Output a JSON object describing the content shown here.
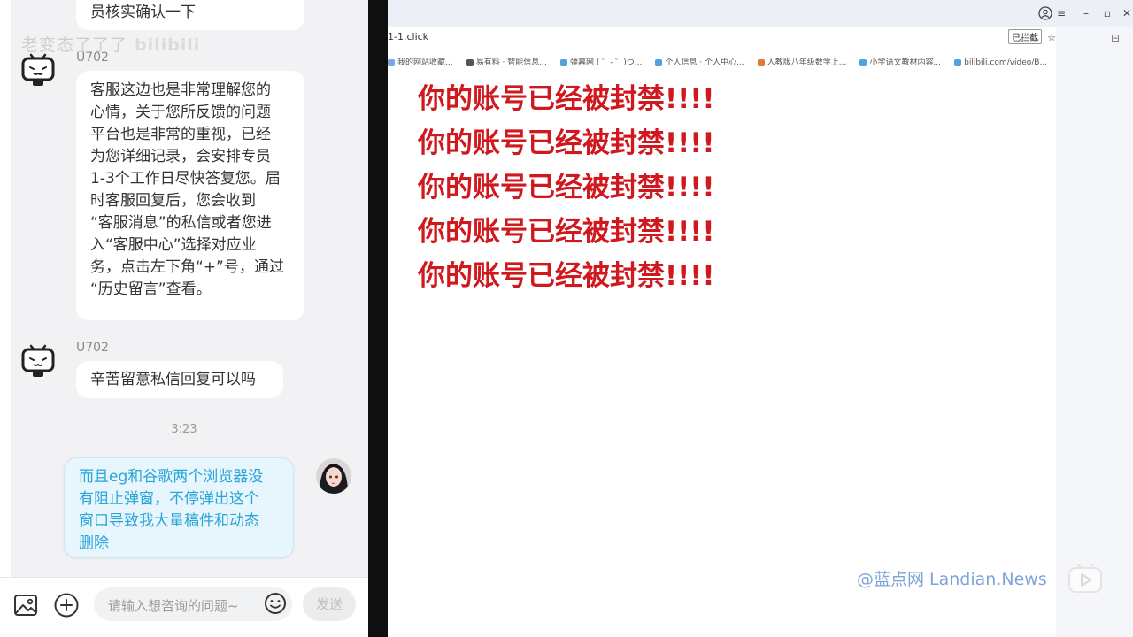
{
  "chat": {
    "watermark": "老变态了了了",
    "watermark_tag": "bilibili",
    "top_partial_message": "员核实确认一下",
    "messages": [
      {
        "sender": "U702",
        "lines": [
          "客服这边也是非常理解您的",
          "心情，关于您所反馈的问题",
          "平台也是非常的重视，已经",
          "为您详细记录，会安排专员",
          "1-3个工作日尽快答复您。届",
          "时客服回复后，您会收到",
          "“客服消息”的私信或者您进",
          "入“客服中心”选择对应业",
          "务，点击左下角“+”号，通过",
          "“历史留言”查看。"
        ]
      },
      {
        "sender": "U702",
        "lines": [
          "辛苦留意私信回复可以吗"
        ]
      }
    ],
    "timestamp": "3:23",
    "self_message": {
      "lines": [
        "而且eg和谷歌两个浏览器没",
        "有阻止弹窗，不停弹出这个",
        "窗口导致我大量稿件和动态",
        "删除"
      ]
    },
    "input": {
      "placeholder": "请输入想咨询的问题~",
      "send_label": "发送"
    }
  },
  "browser": {
    "url": "1-1.click",
    "popup_blocked_label": "已拦截",
    "bookmarks": [
      {
        "label": "我的网站收藏..."
      },
      {
        "label": "易有料 · 智能信息..."
      },
      {
        "label": "弹幕网 ( ゜- ゜)つ..."
      },
      {
        "label": "个人信息 · 个人中心..."
      },
      {
        "label": "人教版八年级数学上..."
      },
      {
        "label": "小学语文教材内容..."
      },
      {
        "label": "bilibili.com/video/B..."
      }
    ],
    "banned_lines": [
      "你的账号已经被封禁!!!!",
      "你的账号已经被封禁!!!!",
      "你的账号已经被封禁!!!!",
      "你的账号已经被封禁!!!!",
      "你的账号已经被封禁!!!!"
    ]
  },
  "site_watermark": "@蓝点网 Landian.News",
  "colors": {
    "banned_text": "#d0191e",
    "self_bubble_text": "#28a6d8",
    "self_bubble_bg": "#e7f5fd",
    "chat_bg": "#f2f2f4"
  }
}
